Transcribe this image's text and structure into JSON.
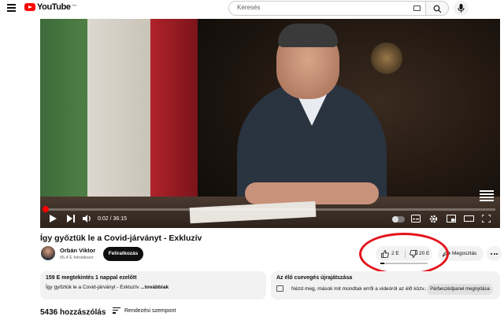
{
  "header": {
    "logo_text": "YouTube",
    "country_code": "HU",
    "search_placeholder": "Keresés"
  },
  "player": {
    "time_display": "0:02 / 36:15",
    "progress_fraction": 0.001
  },
  "video": {
    "title": "Így győztük le a Covid-járványt - Exkluzív"
  },
  "channel": {
    "name": "Orbán Viktor",
    "subscribers": "65,4 E feliratkozó",
    "subscribe_label": "Feliratkozás"
  },
  "actions": {
    "likes": "2 E",
    "dislikes": "20 E",
    "like_ratio": 0.09,
    "share_label": "Megosztás"
  },
  "description": {
    "meta": "159 E megtekintés  1 nappal ezelőtt",
    "text": "Így győztük le a Covid-járványt - Exkluzív ",
    "more": "...továbbiak"
  },
  "chat_replay": {
    "title": "Az élő csevegés újrajátszása",
    "text": "Nézd meg, mások mit mondtak erről a videóról az élő közv...",
    "button": "Párbeszédpanel megnyitása"
  },
  "comments": {
    "count": "5436 hozzászólás",
    "sort_label": "Rendezési szempont"
  },
  "colors": {
    "brand_red": "#ff0000",
    "annotation_red": "#e3141c"
  }
}
